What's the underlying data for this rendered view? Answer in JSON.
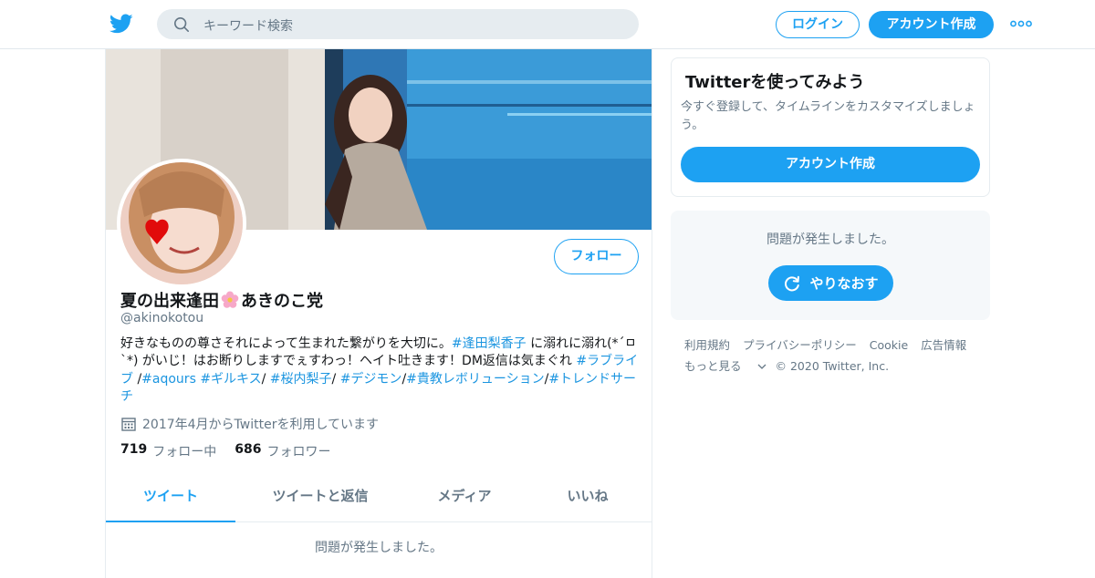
{
  "header": {
    "search_placeholder": "キーワード検索",
    "login_label": "ログイン",
    "signup_label": "アカウント作成"
  },
  "profile": {
    "follow_label": "フォロー",
    "name_part1": "夏の出来逢田",
    "name_part2": "あきのこ党",
    "handle": "@akinokotou",
    "bio_segments": [
      {
        "text": "好きなものの尊さそれによって生まれた繋がりを大切に。",
        "tag": false
      },
      {
        "text": "#逢田梨香子",
        "tag": true
      },
      {
        "text": " に溺れに溺れ(*´ㅁ`*) がいじ！はお断りしますでぇすわっ！ヘイト吐きます！DM返信は気まぐれ ",
        "tag": false
      },
      {
        "text": "#ラブライブ",
        "tag": true
      },
      {
        "text": " /",
        "tag": false
      },
      {
        "text": "#aqours",
        "tag": true
      },
      {
        "text": " ",
        "tag": false
      },
      {
        "text": "#ギルキス",
        "tag": true
      },
      {
        "text": "/ ",
        "tag": false
      },
      {
        "text": "#桜内梨子",
        "tag": true
      },
      {
        "text": "/ ",
        "tag": false
      },
      {
        "text": "#デジモン",
        "tag": true
      },
      {
        "text": "/",
        "tag": false
      },
      {
        "text": "#貴教レボリューション",
        "tag": true
      },
      {
        "text": "/",
        "tag": false
      },
      {
        "text": "#トレンドサーチ",
        "tag": true
      }
    ],
    "joined": "2017年4月からTwitterを利用しています",
    "following_count": "719",
    "following_label": "フォロー中",
    "followers_count": "686",
    "followers_label": "フォロワー"
  },
  "tabs": [
    "ツイート",
    "ツイートと返信",
    "メディア",
    "いいね"
  ],
  "timeline_error": "問題が発生しました。",
  "signup_card": {
    "title": "Twitterを使ってみよう",
    "subtitle": "今すぐ登録して、タイムラインをカスタマイズしましょう。",
    "button": "アカウント作成"
  },
  "error_box": {
    "message": "問題が発生しました。",
    "retry_label": "やりなおす"
  },
  "footer": {
    "links": [
      "利用規約",
      "プライバシーポリシー",
      "Cookie",
      "広告情報"
    ],
    "more": "もっと見る",
    "copyright": "© 2020 Twitter, Inc."
  },
  "colors": {
    "accent": "#1da1f2",
    "link": "#1b95e0",
    "muted": "#657786"
  },
  "icons": [
    "twitter-bird-icon",
    "search-icon",
    "more-dots-icon",
    "flower-emoji-icon",
    "calendar-icon",
    "refresh-icon",
    "chevron-down-icon"
  ]
}
